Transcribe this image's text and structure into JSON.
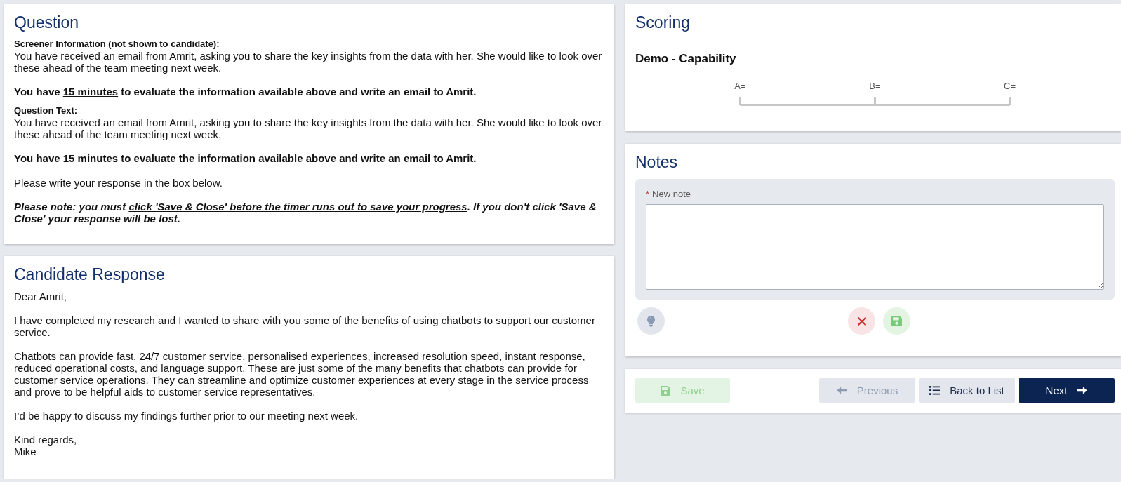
{
  "question": {
    "title": "Question",
    "blocks": [
      {
        "kind": "label",
        "segments": [
          {
            "text": "Screener Information (not shown to candidate):",
            "underline": false
          }
        ]
      },
      {
        "kind": "text",
        "segments": [
          {
            "text": "You have received an email from Amrit, asking you to share the key insights from the data with her. She would like to look over these ahead of the team meeting next week.",
            "underline": false
          }
        ]
      },
      {
        "kind": "emphasis",
        "segments": [
          {
            "text": "You have ",
            "underline": false
          },
          {
            "text": "15 minutes",
            "underline": true
          },
          {
            "text": " to evaluate the information available above and write an email to Amrit.",
            "underline": false
          }
        ]
      },
      {
        "kind": "label",
        "segments": [
          {
            "text": "Question Text:",
            "underline": false
          }
        ]
      },
      {
        "kind": "text",
        "segments": [
          {
            "text": "You have received an email from Amrit, asking you to share the key insights from the data with her. She would like to look over these ahead of the team meeting next week.",
            "underline": false
          }
        ]
      },
      {
        "kind": "emphasis",
        "segments": [
          {
            "text": "You have ",
            "underline": false
          },
          {
            "text": "15 minutes",
            "underline": true
          },
          {
            "text": " to evaluate the information available above and write an email to Amrit.",
            "underline": false
          }
        ]
      },
      {
        "kind": "text",
        "segments": [
          {
            "text": "Please write your response in the box below.",
            "underline": false
          }
        ]
      },
      {
        "kind": "note",
        "segments": [
          {
            "text": "Please note: you must ",
            "underline": false
          },
          {
            "text": "click 'Save & Close' before the timer runs out to save your progress",
            "underline": true
          },
          {
            "text": ". If you don't click 'Save & Close' your response will be lost.",
            "underline": false
          }
        ]
      }
    ]
  },
  "candidate_response": {
    "title": "Candidate Response",
    "paragraphs": [
      "Dear Amrit,",
      "I have completed my research and I wanted to share with you some of the benefits of using chatbots to support our customer service.",
      "Chatbots can provide fast, 24/7 customer service, personalised experiences, increased resolution speed, instant response, reduced operational costs, and language support. These are just some of the many benefits that chatbots can provide for customer service operations. They can streamline and optimize customer experiences at every stage in the service process and prove to be helpful aids to customer service representatives.",
      "I’d be happy to discuss my findings further prior to our meeting next week.",
      "Kind regards,\nMike"
    ]
  },
  "scoring": {
    "title": "Scoring",
    "criterion": "Demo - Capability",
    "scale_labels": [
      "A=",
      "B=",
      "C="
    ]
  },
  "notes": {
    "title": "Notes",
    "field": {
      "required_mark": "*",
      "label": "New note"
    },
    "actions": [
      {
        "kind": "hint"
      },
      {
        "kind": "cancel"
      },
      {
        "kind": "save"
      }
    ]
  },
  "footer_buttons": [
    {
      "kind": "save",
      "label": "Save",
      "disabled": true
    },
    {
      "kind": "previous",
      "label": "Previous",
      "disabled": true
    },
    {
      "kind": "list",
      "label": "Back to List",
      "disabled": false
    },
    {
      "kind": "next",
      "label": "Next",
      "disabled": false
    }
  ]
}
